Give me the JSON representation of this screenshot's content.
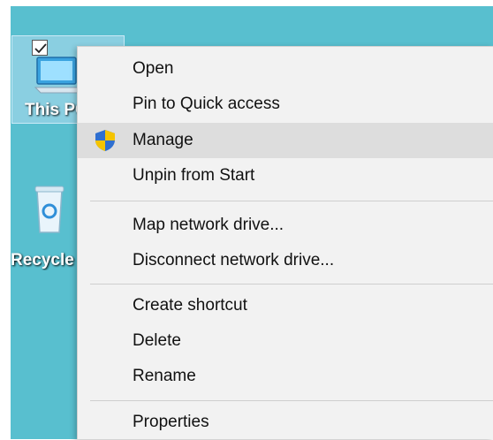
{
  "desktop": {
    "icons": [
      {
        "label": "This PC",
        "icon": "computer-icon",
        "selected": true
      },
      {
        "label": "Recycle Bin",
        "icon": "recycle-bin-icon"
      }
    ]
  },
  "context_menu": {
    "items": [
      {
        "label": "Open"
      },
      {
        "label": "Pin to Quick access"
      },
      {
        "label": "Manage",
        "icon": "uac-shield-icon",
        "highlighted": true
      },
      {
        "label": "Unpin from Start"
      },
      {
        "label": "Map network drive..."
      },
      {
        "label": "Disconnect network drive..."
      },
      {
        "label": "Create shortcut"
      },
      {
        "label": "Delete"
      },
      {
        "label": "Rename"
      },
      {
        "label": "Properties"
      }
    ]
  },
  "colors": {
    "desktop": "#58bfcf",
    "menu_background": "#f2f2f2",
    "menu_highlight": "#dddddd",
    "shield_blue": "#2f6fd0",
    "shield_yellow": "#f5c400"
  }
}
